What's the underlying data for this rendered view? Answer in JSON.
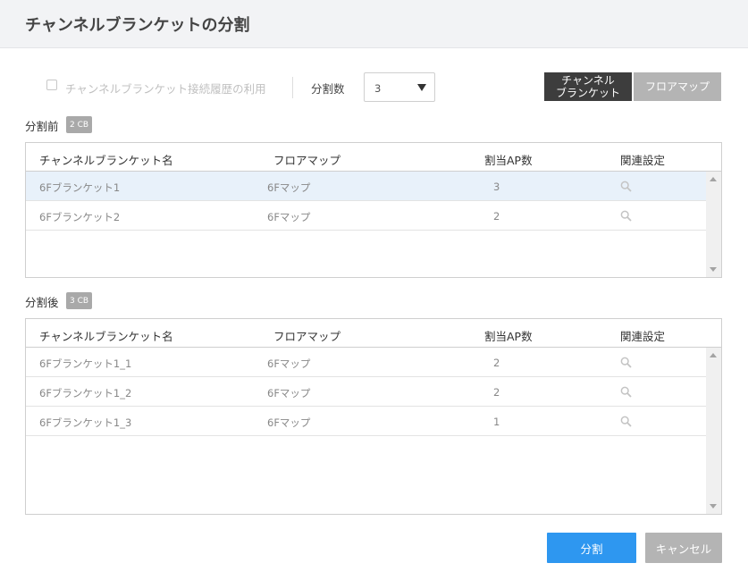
{
  "dialog": {
    "title": "チャンネルブランケットの分割"
  },
  "controls": {
    "history_checkbox_label": "チャンネルブランケット接続履歴の利用",
    "split_count_label": "分割数",
    "split_count_value": "3",
    "view_toggle": {
      "active_line1": "チャンネル",
      "active_line2": "ブランケット",
      "inactive": "フロアマップ"
    }
  },
  "columns": {
    "name": "チャンネルブランケット名",
    "floormap": "フロアマップ",
    "ap_count": "割当AP数",
    "settings": "関連設定"
  },
  "before": {
    "label": "分割前",
    "badge": "2 CB",
    "rows": [
      {
        "name": "6Fブランケット1",
        "floormap": "6Fマップ",
        "ap_count": "3"
      },
      {
        "name": "6Fブランケット2",
        "floormap": "6Fマップ",
        "ap_count": "2"
      }
    ]
  },
  "after": {
    "label": "分割後",
    "badge": "3 CB",
    "rows": [
      {
        "name": "6Fブランケット1_1",
        "floormap": "6Fマップ",
        "ap_count": "2"
      },
      {
        "name": "6Fブランケット1_2",
        "floormap": "6Fマップ",
        "ap_count": "2"
      },
      {
        "name": "6Fブランケット1_3",
        "floormap": "6Fマップ",
        "ap_count": "1"
      }
    ]
  },
  "footer": {
    "split_button": "分割",
    "cancel_button": "キャンセル"
  },
  "icons": {
    "settings": "magnifier-icon",
    "dropdown": "caret-down-icon"
  },
  "colors": {
    "primary": "#2e97f0",
    "toggle_active": "#3d3d3d",
    "toggle_inactive": "#b4b4b4",
    "selected_row": "#e8f1fa"
  }
}
